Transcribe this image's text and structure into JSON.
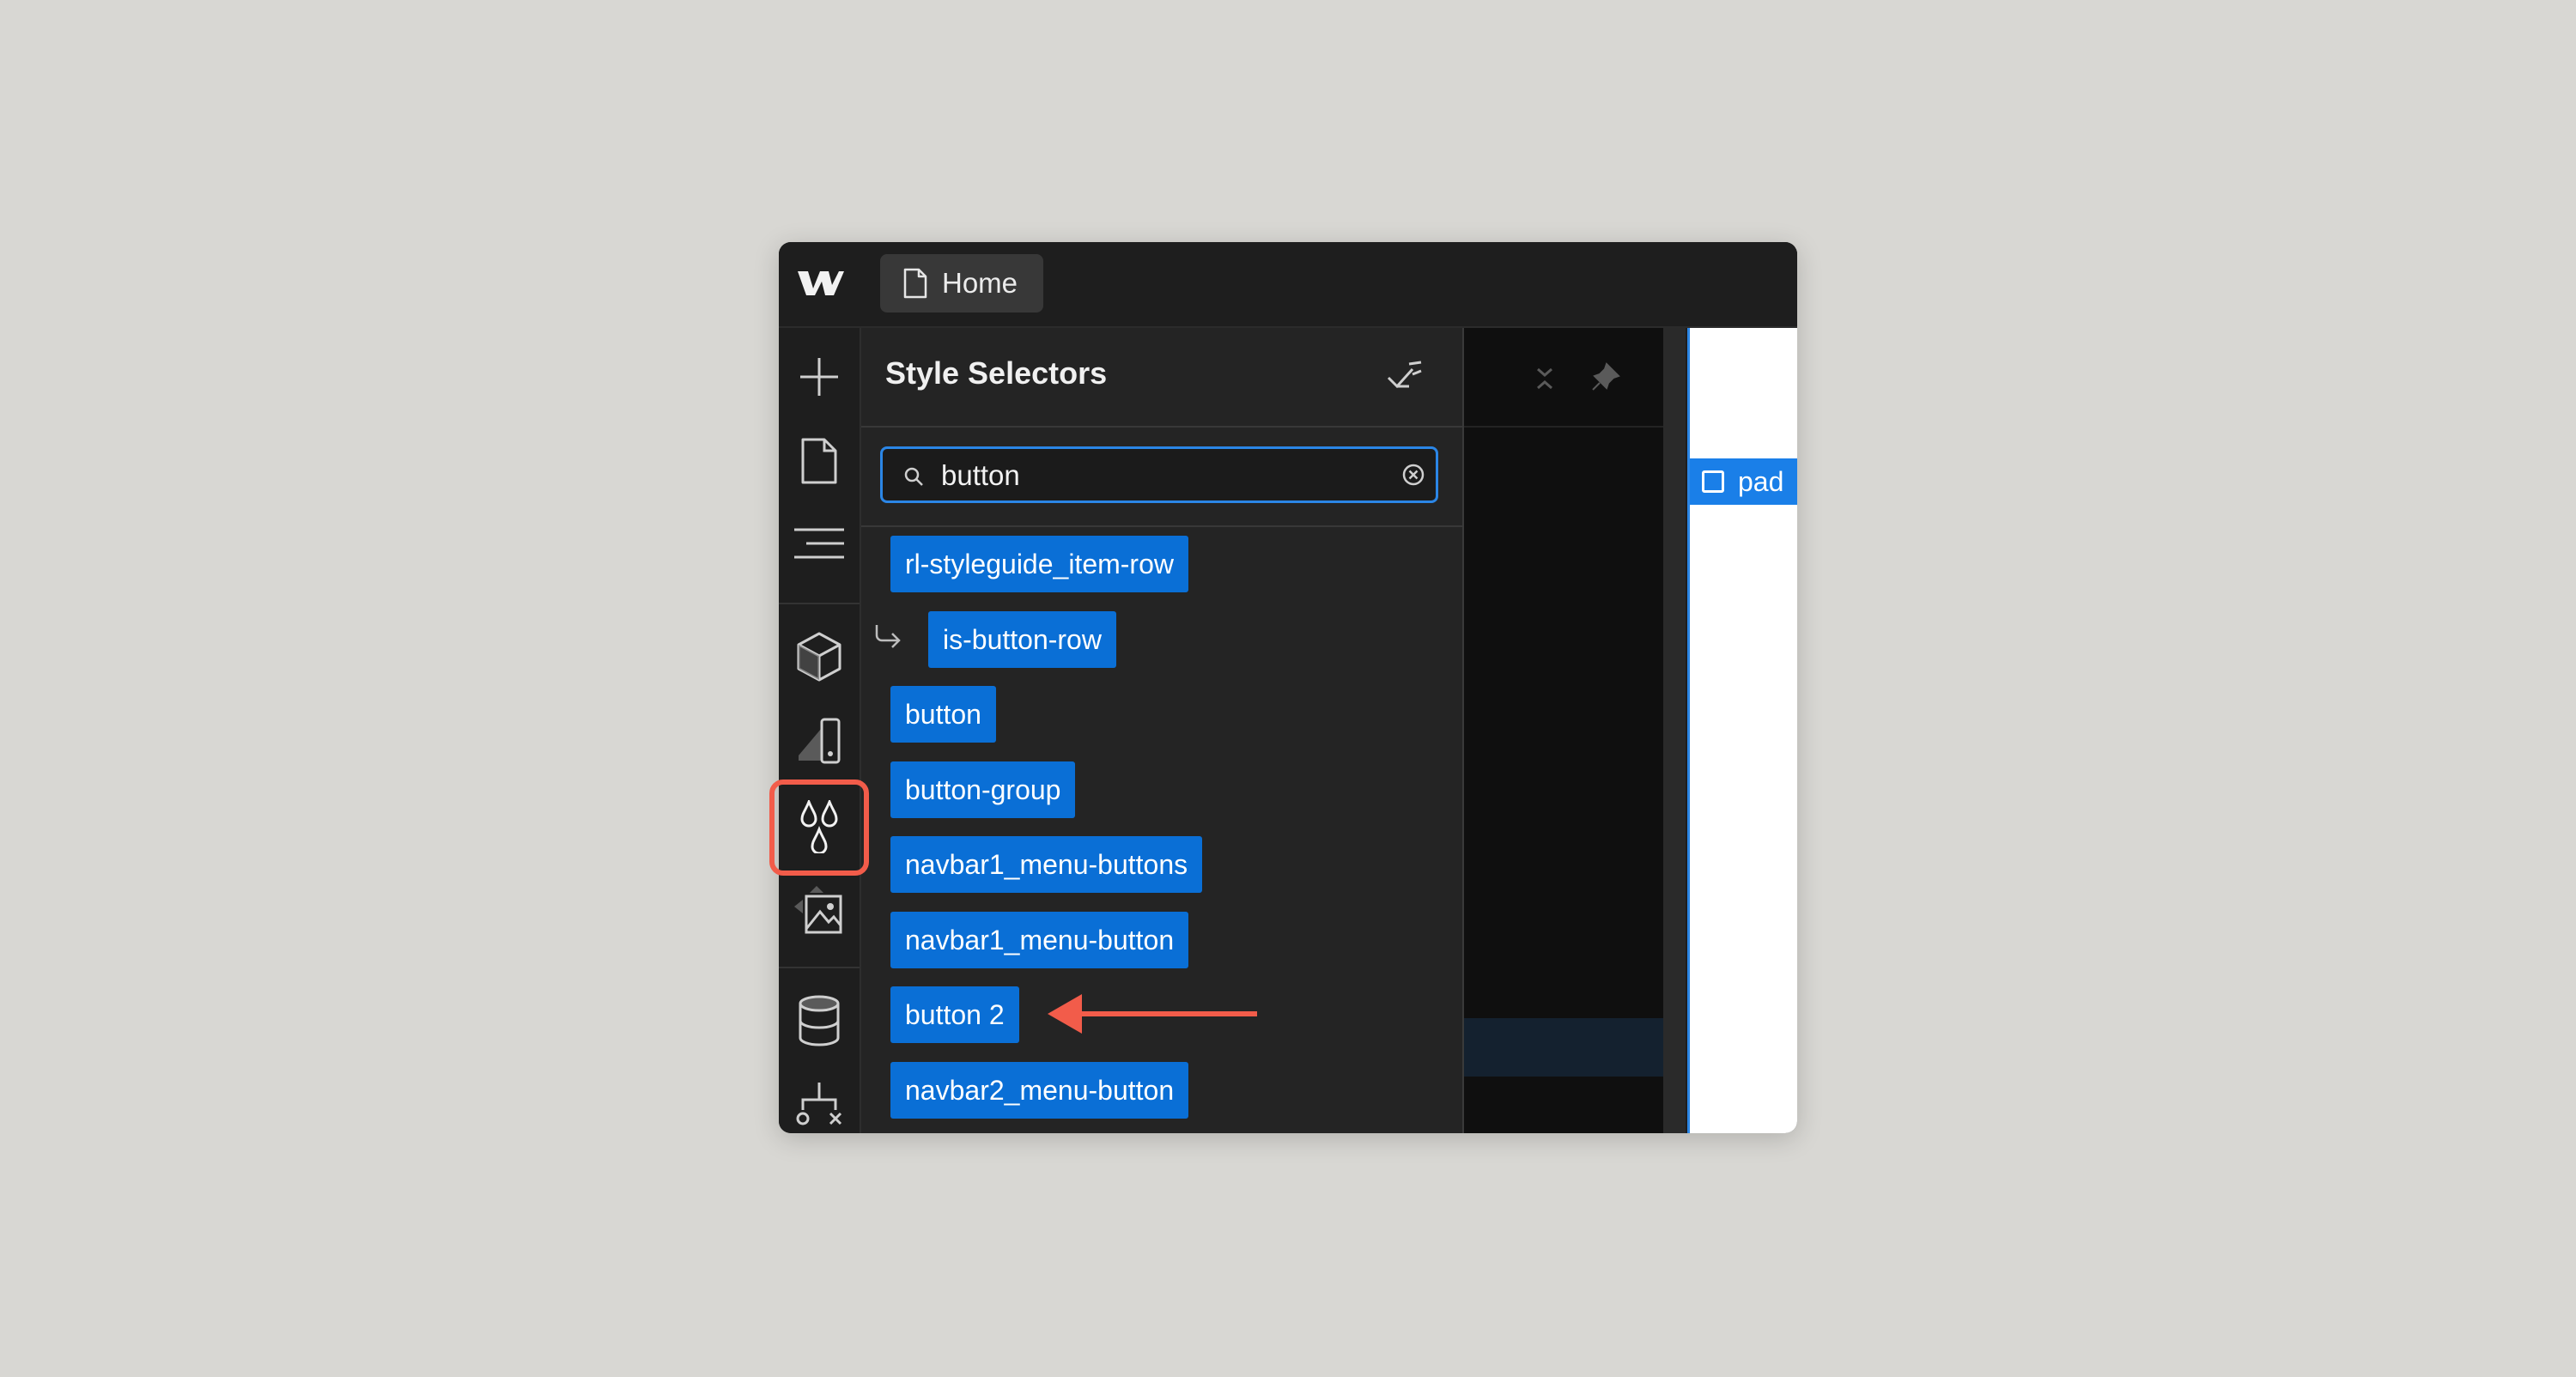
{
  "topbar": {
    "page_tab_label": "Home"
  },
  "rail": {
    "items": [
      "add-icon",
      "pages-icon",
      "navigator-icon",
      "components-icon",
      "variables-icon",
      "style-selectors-icon",
      "assets-icon",
      "cms-icon",
      "logic-icon"
    ],
    "active": "style-selectors-icon"
  },
  "panel": {
    "title": "Style Selectors",
    "search": {
      "value": "button"
    },
    "selectors": [
      {
        "label": "rl-styleguide_item-row",
        "nested": false
      },
      {
        "label": "is-button-row",
        "nested": true
      },
      {
        "label": "button",
        "nested": false
      },
      {
        "label": "button-group",
        "nested": false
      },
      {
        "label": "navbar1_menu-buttons",
        "nested": false
      },
      {
        "label": "navbar1_menu-button",
        "nested": false
      },
      {
        "label": "button 2",
        "nested": false
      },
      {
        "label": "navbar2_menu-button",
        "nested": false
      }
    ]
  },
  "canvas": {
    "selected_label": "pad"
  },
  "colors": {
    "background": "#d8d7d3",
    "chip": "#0a6fd6",
    "focus": "#2b86e6",
    "annotation": "#f25c4a"
  }
}
